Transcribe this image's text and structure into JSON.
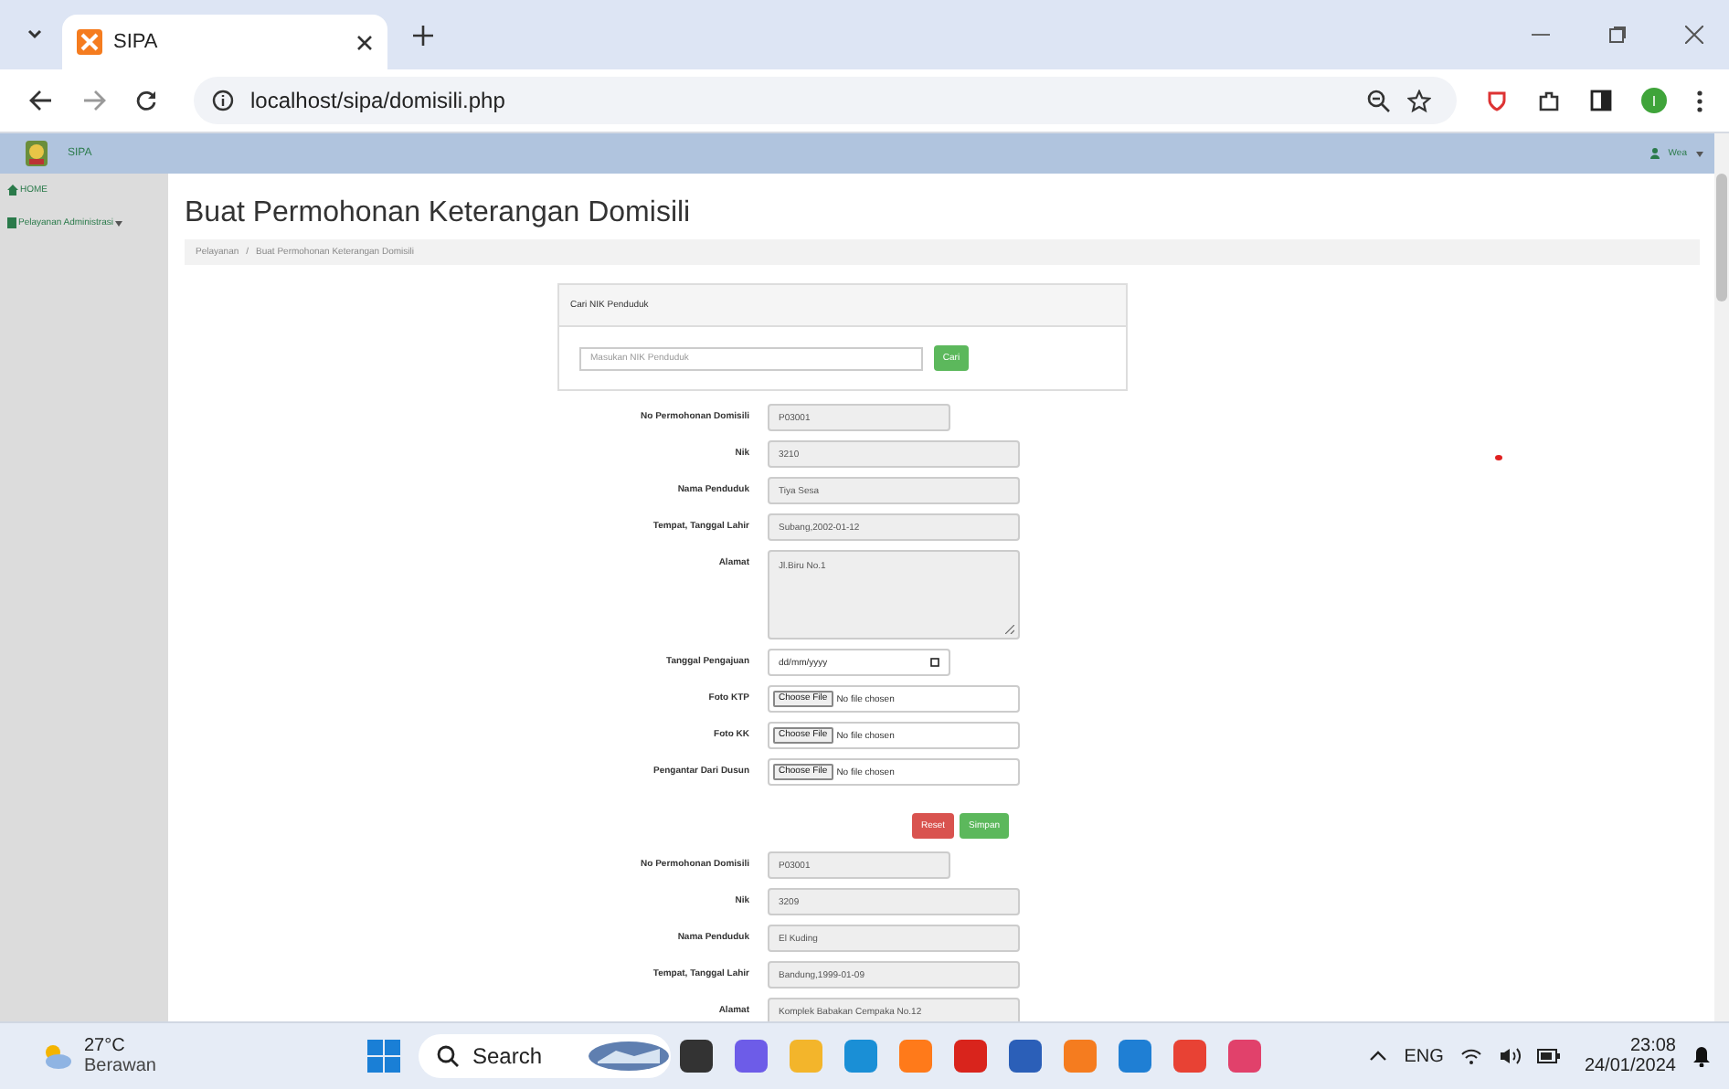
{
  "browser": {
    "tab_title": "SIPA",
    "url": "localhost/sipa/domisili.php",
    "profile_initial": "I"
  },
  "navbar": {
    "brand": "SIPA",
    "user": "Wea"
  },
  "sidebar": {
    "items": [
      {
        "label": "HOME",
        "kind": "home"
      },
      {
        "label": "Pelayanan Administrasi",
        "kind": "menu"
      }
    ]
  },
  "page_title": "Buat Permohonan Keterangan Domisili",
  "breadcrumb": [
    "Pelayanan",
    "/",
    "Buat Permohonan Keterangan Domisili"
  ],
  "search_panel": {
    "heading": "Cari NIK Penduduk",
    "placeholder": "Masukan NIK Penduduk",
    "button": "Cari"
  },
  "form": [
    {
      "label": "No Permohonan Domisili",
      "kind": "short_text",
      "value": "P03001"
    },
    {
      "label": "Nik",
      "kind": "text",
      "value": "3210"
    },
    {
      "label": "Nama Penduduk",
      "kind": "text",
      "value": "Tiya Sesa"
    },
    {
      "label": "Tempat, Tanggal Lahir",
      "kind": "text",
      "value": "Subang,2002-01-12"
    },
    {
      "label": "Alamat",
      "kind": "textarea",
      "value": "Jl.Biru No.1"
    },
    {
      "label": "Tanggal Pengajuan",
      "kind": "date",
      "placeholder": "dd/mm/yyyy"
    },
    {
      "label": "Foto KTP",
      "kind": "file",
      "button": "Choose File",
      "status": "No file chosen"
    },
    {
      "label": "Foto KK",
      "kind": "file",
      "button": "Choose File",
      "status": "No file chosen"
    },
    {
      "label": "Pengantar Dari Dusun",
      "kind": "file",
      "button": "Choose File",
      "status": "No file chosen"
    }
  ],
  "form_buttons": [
    {
      "label": "Reset",
      "kind": "danger"
    },
    {
      "label": "Simpan",
      "kind": "success"
    }
  ],
  "record": [
    {
      "label": "No Permohonan Domisili",
      "kind": "short_text",
      "value": "P03001"
    },
    {
      "label": "Nik",
      "kind": "text",
      "value": "3209"
    },
    {
      "label": "Nama Penduduk",
      "kind": "text",
      "value": "El Kuding"
    },
    {
      "label": "Tempat, Tanggal Lahir",
      "kind": "text",
      "value": "Bandung,1999-01-09"
    },
    {
      "label": "Alamat",
      "kind": "text",
      "value": "Komplek Babakan Cempaka No.12"
    }
  ],
  "taskbar": {
    "temperature": "27°C",
    "weather": "Berawan",
    "search": "Search",
    "language": "ENG",
    "time": "23:08",
    "date": "24/01/2024"
  }
}
